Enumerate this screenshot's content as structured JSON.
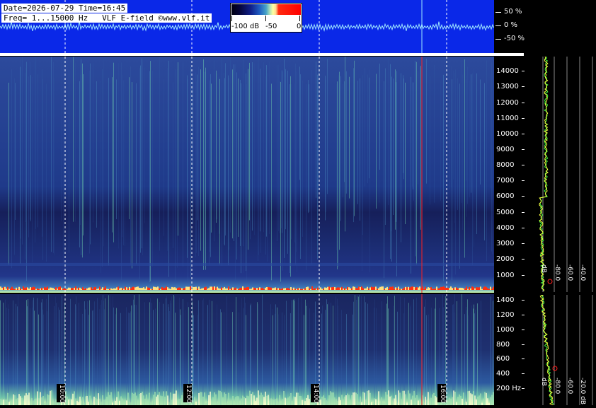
{
  "header": {
    "line1": "Date=2026-07-29 Time=16:45",
    "line2": "Freq= 1...15000 Hz   VLF E-field ©www.vlf.it"
  },
  "colorbar": {
    "labels": [
      "-100 dB",
      "-50",
      "0"
    ]
  },
  "percent_scale": [
    "50 %",
    "0 %",
    "-50 %"
  ],
  "freq_axis_upper": [
    "14000",
    "13000",
    "12000",
    "11000",
    "10000",
    "9000",
    "8000",
    "7000",
    "6000",
    "5000",
    "4000",
    "3000",
    "2000",
    "1000"
  ],
  "freq_axis_lower": [
    "1400",
    "1200",
    "1000",
    "800",
    "600",
    "400",
    "200 Hz"
  ],
  "profile_db_labels": [
    "dB",
    "-80.0",
    "-60.0",
    "-40.0",
    "-20.0 dB"
  ],
  "time_labels": [
    "10:00",
    "12:00",
    "14:00",
    "16:00"
  ],
  "colors": {
    "waveform_bg": "#0a28e8",
    "spectrogram_bg": "#1a2a7a",
    "grid": "#ffffff",
    "marker": "#ff2020",
    "noise_floor": "#ff3010"
  }
}
